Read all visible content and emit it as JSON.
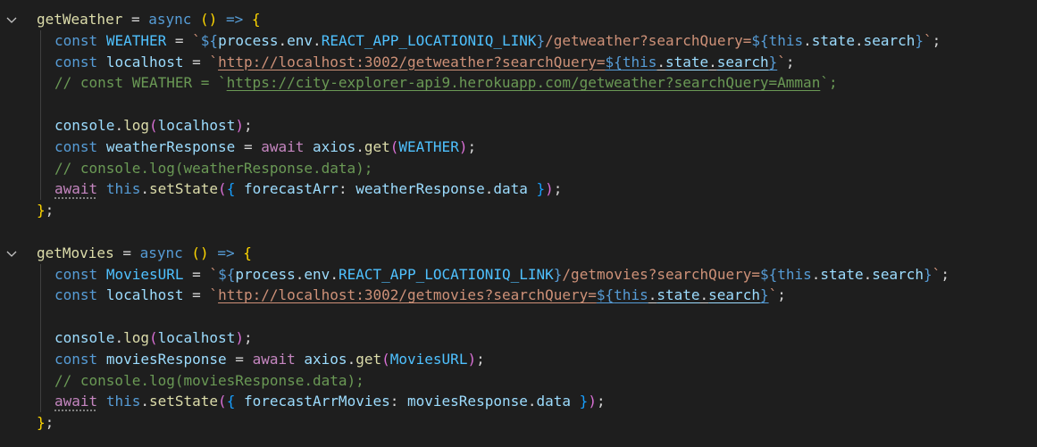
{
  "editor": {
    "lines": [
      {
        "indent": 0,
        "tokens": [
          {
            "t": "getWeather",
            "c": "fn"
          },
          {
            "t": " = ",
            "c": "op"
          },
          {
            "t": "async",
            "c": "kw"
          },
          {
            "t": " ",
            "c": "op"
          },
          {
            "t": "()",
            "c": "br1"
          },
          {
            "t": " ",
            "c": "op"
          },
          {
            "t": "=>",
            "c": "kw"
          },
          {
            "t": " ",
            "c": "op"
          },
          {
            "t": "{",
            "c": "br1"
          }
        ]
      },
      {
        "indent": 1,
        "tokens": [
          {
            "t": "const",
            "c": "kw"
          },
          {
            "t": " ",
            "c": "op"
          },
          {
            "t": "WEATHER",
            "c": "c"
          },
          {
            "t": " = ",
            "c": "op"
          },
          {
            "t": "`",
            "c": "s"
          },
          {
            "t": "${",
            "c": "kw"
          },
          {
            "t": "process",
            "c": "v"
          },
          {
            "t": ".",
            "c": "op"
          },
          {
            "t": "env",
            "c": "v"
          },
          {
            "t": ".",
            "c": "op"
          },
          {
            "t": "REACT_APP_LOCATIONIQ_LINK",
            "c": "c"
          },
          {
            "t": "}",
            "c": "kw"
          },
          {
            "t": "/getweather?searchQuery=",
            "c": "s"
          },
          {
            "t": "${",
            "c": "kw"
          },
          {
            "t": "this",
            "c": "kw"
          },
          {
            "t": ".",
            "c": "op"
          },
          {
            "t": "state",
            "c": "v"
          },
          {
            "t": ".",
            "c": "op"
          },
          {
            "t": "search",
            "c": "v"
          },
          {
            "t": "}",
            "c": "kw"
          },
          {
            "t": "`",
            "c": "s"
          },
          {
            "t": ";",
            "c": "op"
          }
        ]
      },
      {
        "indent": 1,
        "tokens": [
          {
            "t": "const",
            "c": "kw"
          },
          {
            "t": " ",
            "c": "op"
          },
          {
            "t": "localhost",
            "c": "v"
          },
          {
            "t": " = ",
            "c": "op"
          },
          {
            "t": "`",
            "c": "s"
          },
          {
            "t": "http://localhost:3002/getweather?searchQuery=",
            "c": "s u"
          },
          {
            "t": "${",
            "c": "kw u"
          },
          {
            "t": "this",
            "c": "kw u"
          },
          {
            "t": ".",
            "c": "op u"
          },
          {
            "t": "state",
            "c": "v u"
          },
          {
            "t": ".",
            "c": "op u"
          },
          {
            "t": "search",
            "c": "v u"
          },
          {
            "t": "}",
            "c": "kw u"
          },
          {
            "t": "`",
            "c": "s"
          },
          {
            "t": ";",
            "c": "op"
          }
        ]
      },
      {
        "indent": 1,
        "tokens": [
          {
            "t": "// const WEATHER = `",
            "c": "cm"
          },
          {
            "t": "https://city-explorer-api9.herokuapp.com/getweather?searchQuery=Amman",
            "c": "cm u"
          },
          {
            "t": "`;",
            "c": "cm"
          }
        ]
      },
      {
        "indent": 0,
        "tokens": []
      },
      {
        "indent": 1,
        "tokens": [
          {
            "t": "console",
            "c": "v"
          },
          {
            "t": ".",
            "c": "op"
          },
          {
            "t": "log",
            "c": "fn"
          },
          {
            "t": "(",
            "c": "br2"
          },
          {
            "t": "localhost",
            "c": "v"
          },
          {
            "t": ")",
            "c": "br2"
          },
          {
            "t": ";",
            "c": "op"
          }
        ]
      },
      {
        "indent": 1,
        "tokens": [
          {
            "t": "const",
            "c": "kw"
          },
          {
            "t": " ",
            "c": "op"
          },
          {
            "t": "weatherResponse",
            "c": "v"
          },
          {
            "t": " = ",
            "c": "op"
          },
          {
            "t": "await",
            "c": "ctl"
          },
          {
            "t": " ",
            "c": "op"
          },
          {
            "t": "axios",
            "c": "v"
          },
          {
            "t": ".",
            "c": "op"
          },
          {
            "t": "get",
            "c": "fn"
          },
          {
            "t": "(",
            "c": "br2"
          },
          {
            "t": "WEATHER",
            "c": "c"
          },
          {
            "t": ")",
            "c": "br2"
          },
          {
            "t": ";",
            "c": "op"
          }
        ]
      },
      {
        "indent": 1,
        "tokens": [
          {
            "t": "// console.log(weatherResponse.data);",
            "c": "cm"
          }
        ]
      },
      {
        "indent": 1,
        "tokens": [
          {
            "t": "await",
            "c": "ctl dots"
          },
          {
            "t": " ",
            "c": "op"
          },
          {
            "t": "this",
            "c": "kw"
          },
          {
            "t": ".",
            "c": "op"
          },
          {
            "t": "setState",
            "c": "fn"
          },
          {
            "t": "(",
            "c": "br2"
          },
          {
            "t": "{",
            "c": "br3"
          },
          {
            "t": " ",
            "c": "op"
          },
          {
            "t": "forecastArr",
            "c": "v"
          },
          {
            "t": ": ",
            "c": "op"
          },
          {
            "t": "weatherResponse",
            "c": "v"
          },
          {
            "t": ".",
            "c": "op"
          },
          {
            "t": "data",
            "c": "v"
          },
          {
            "t": " ",
            "c": "op"
          },
          {
            "t": "}",
            "c": "br3"
          },
          {
            "t": ")",
            "c": "br2"
          },
          {
            "t": ";",
            "c": "op"
          }
        ]
      },
      {
        "indent": 0,
        "tokens": [
          {
            "t": "}",
            "c": "br1"
          },
          {
            "t": ";",
            "c": "op"
          }
        ]
      },
      {
        "indent": 0,
        "tokens": []
      },
      {
        "indent": 0,
        "tokens": [
          {
            "t": "getMovies",
            "c": "fn"
          },
          {
            "t": " = ",
            "c": "op"
          },
          {
            "t": "async",
            "c": "kw"
          },
          {
            "t": " ",
            "c": "op"
          },
          {
            "t": "()",
            "c": "br1"
          },
          {
            "t": " ",
            "c": "op"
          },
          {
            "t": "=>",
            "c": "kw"
          },
          {
            "t": " ",
            "c": "op"
          },
          {
            "t": "{",
            "c": "br1"
          }
        ]
      },
      {
        "indent": 1,
        "tokens": [
          {
            "t": "const",
            "c": "kw"
          },
          {
            "t": " ",
            "c": "op"
          },
          {
            "t": "MoviesURL",
            "c": "c"
          },
          {
            "t": " = ",
            "c": "op"
          },
          {
            "t": "`",
            "c": "s"
          },
          {
            "t": "${",
            "c": "kw"
          },
          {
            "t": "process",
            "c": "v"
          },
          {
            "t": ".",
            "c": "op"
          },
          {
            "t": "env",
            "c": "v"
          },
          {
            "t": ".",
            "c": "op"
          },
          {
            "t": "REACT_APP_LOCATIONIQ_LINK",
            "c": "c"
          },
          {
            "t": "}",
            "c": "kw"
          },
          {
            "t": "/getmovies?searchQuery=",
            "c": "s"
          },
          {
            "t": "${",
            "c": "kw"
          },
          {
            "t": "this",
            "c": "kw"
          },
          {
            "t": ".",
            "c": "op"
          },
          {
            "t": "state",
            "c": "v"
          },
          {
            "t": ".",
            "c": "op"
          },
          {
            "t": "search",
            "c": "v"
          },
          {
            "t": "}",
            "c": "kw"
          },
          {
            "t": "`",
            "c": "s"
          },
          {
            "t": ";",
            "c": "op"
          }
        ]
      },
      {
        "indent": 1,
        "tokens": [
          {
            "t": "const",
            "c": "kw"
          },
          {
            "t": " ",
            "c": "op"
          },
          {
            "t": "localhost",
            "c": "v"
          },
          {
            "t": " = ",
            "c": "op"
          },
          {
            "t": "`",
            "c": "s"
          },
          {
            "t": "http://localhost:3002/getmovies?searchQuery=",
            "c": "s u"
          },
          {
            "t": "${",
            "c": "kw u"
          },
          {
            "t": "this",
            "c": "kw u"
          },
          {
            "t": ".",
            "c": "op u"
          },
          {
            "t": "state",
            "c": "v u"
          },
          {
            "t": ".",
            "c": "op u"
          },
          {
            "t": "search",
            "c": "v u"
          },
          {
            "t": "}",
            "c": "kw u"
          },
          {
            "t": "`",
            "c": "s"
          },
          {
            "t": ";",
            "c": "op"
          }
        ]
      },
      {
        "indent": 0,
        "tokens": []
      },
      {
        "indent": 1,
        "tokens": [
          {
            "t": "console",
            "c": "v"
          },
          {
            "t": ".",
            "c": "op"
          },
          {
            "t": "log",
            "c": "fn"
          },
          {
            "t": "(",
            "c": "br2"
          },
          {
            "t": "localhost",
            "c": "v"
          },
          {
            "t": ")",
            "c": "br2"
          },
          {
            "t": ";",
            "c": "op"
          }
        ]
      },
      {
        "indent": 1,
        "tokens": [
          {
            "t": "const",
            "c": "kw"
          },
          {
            "t": " ",
            "c": "op"
          },
          {
            "t": "moviesResponse",
            "c": "v"
          },
          {
            "t": " = ",
            "c": "op"
          },
          {
            "t": "await",
            "c": "ctl"
          },
          {
            "t": " ",
            "c": "op"
          },
          {
            "t": "axios",
            "c": "v"
          },
          {
            "t": ".",
            "c": "op"
          },
          {
            "t": "get",
            "c": "fn"
          },
          {
            "t": "(",
            "c": "br2"
          },
          {
            "t": "MoviesURL",
            "c": "c"
          },
          {
            "t": ")",
            "c": "br2"
          },
          {
            "t": ";",
            "c": "op"
          }
        ]
      },
      {
        "indent": 1,
        "tokens": [
          {
            "t": "// console.log(moviesResponse.data);",
            "c": "cm"
          }
        ]
      },
      {
        "indent": 1,
        "tokens": [
          {
            "t": "await",
            "c": "ctl dots"
          },
          {
            "t": " ",
            "c": "op"
          },
          {
            "t": "this",
            "c": "kw"
          },
          {
            "t": ".",
            "c": "op"
          },
          {
            "t": "setState",
            "c": "fn"
          },
          {
            "t": "(",
            "c": "br2"
          },
          {
            "t": "{",
            "c": "br3"
          },
          {
            "t": " ",
            "c": "op"
          },
          {
            "t": "forecastArrMovies",
            "c": "v"
          },
          {
            "t": ": ",
            "c": "op"
          },
          {
            "t": "moviesResponse",
            "c": "v"
          },
          {
            "t": ".",
            "c": "op"
          },
          {
            "t": "data",
            "c": "v"
          },
          {
            "t": " ",
            "c": "op"
          },
          {
            "t": "}",
            "c": "br3"
          },
          {
            "t": ")",
            "c": "br2"
          },
          {
            "t": ";",
            "c": "op"
          }
        ]
      },
      {
        "indent": 0,
        "tokens": [
          {
            "t": "}",
            "c": "br1"
          },
          {
            "t": ";",
            "c": "op"
          }
        ]
      }
    ],
    "folds": [
      {
        "line": 0,
        "icon": "chevron-down-icon"
      },
      {
        "line": 11,
        "icon": "chevron-down-icon"
      }
    ],
    "colors": {
      "background": "#1e1e1e",
      "function": "#dcdcaa",
      "keyword": "#569cd6",
      "control": "#c586c0",
      "variable": "#9cdcfe",
      "constant": "#4fc1ff",
      "string": "#ce9178",
      "comment": "#6a9955"
    }
  }
}
